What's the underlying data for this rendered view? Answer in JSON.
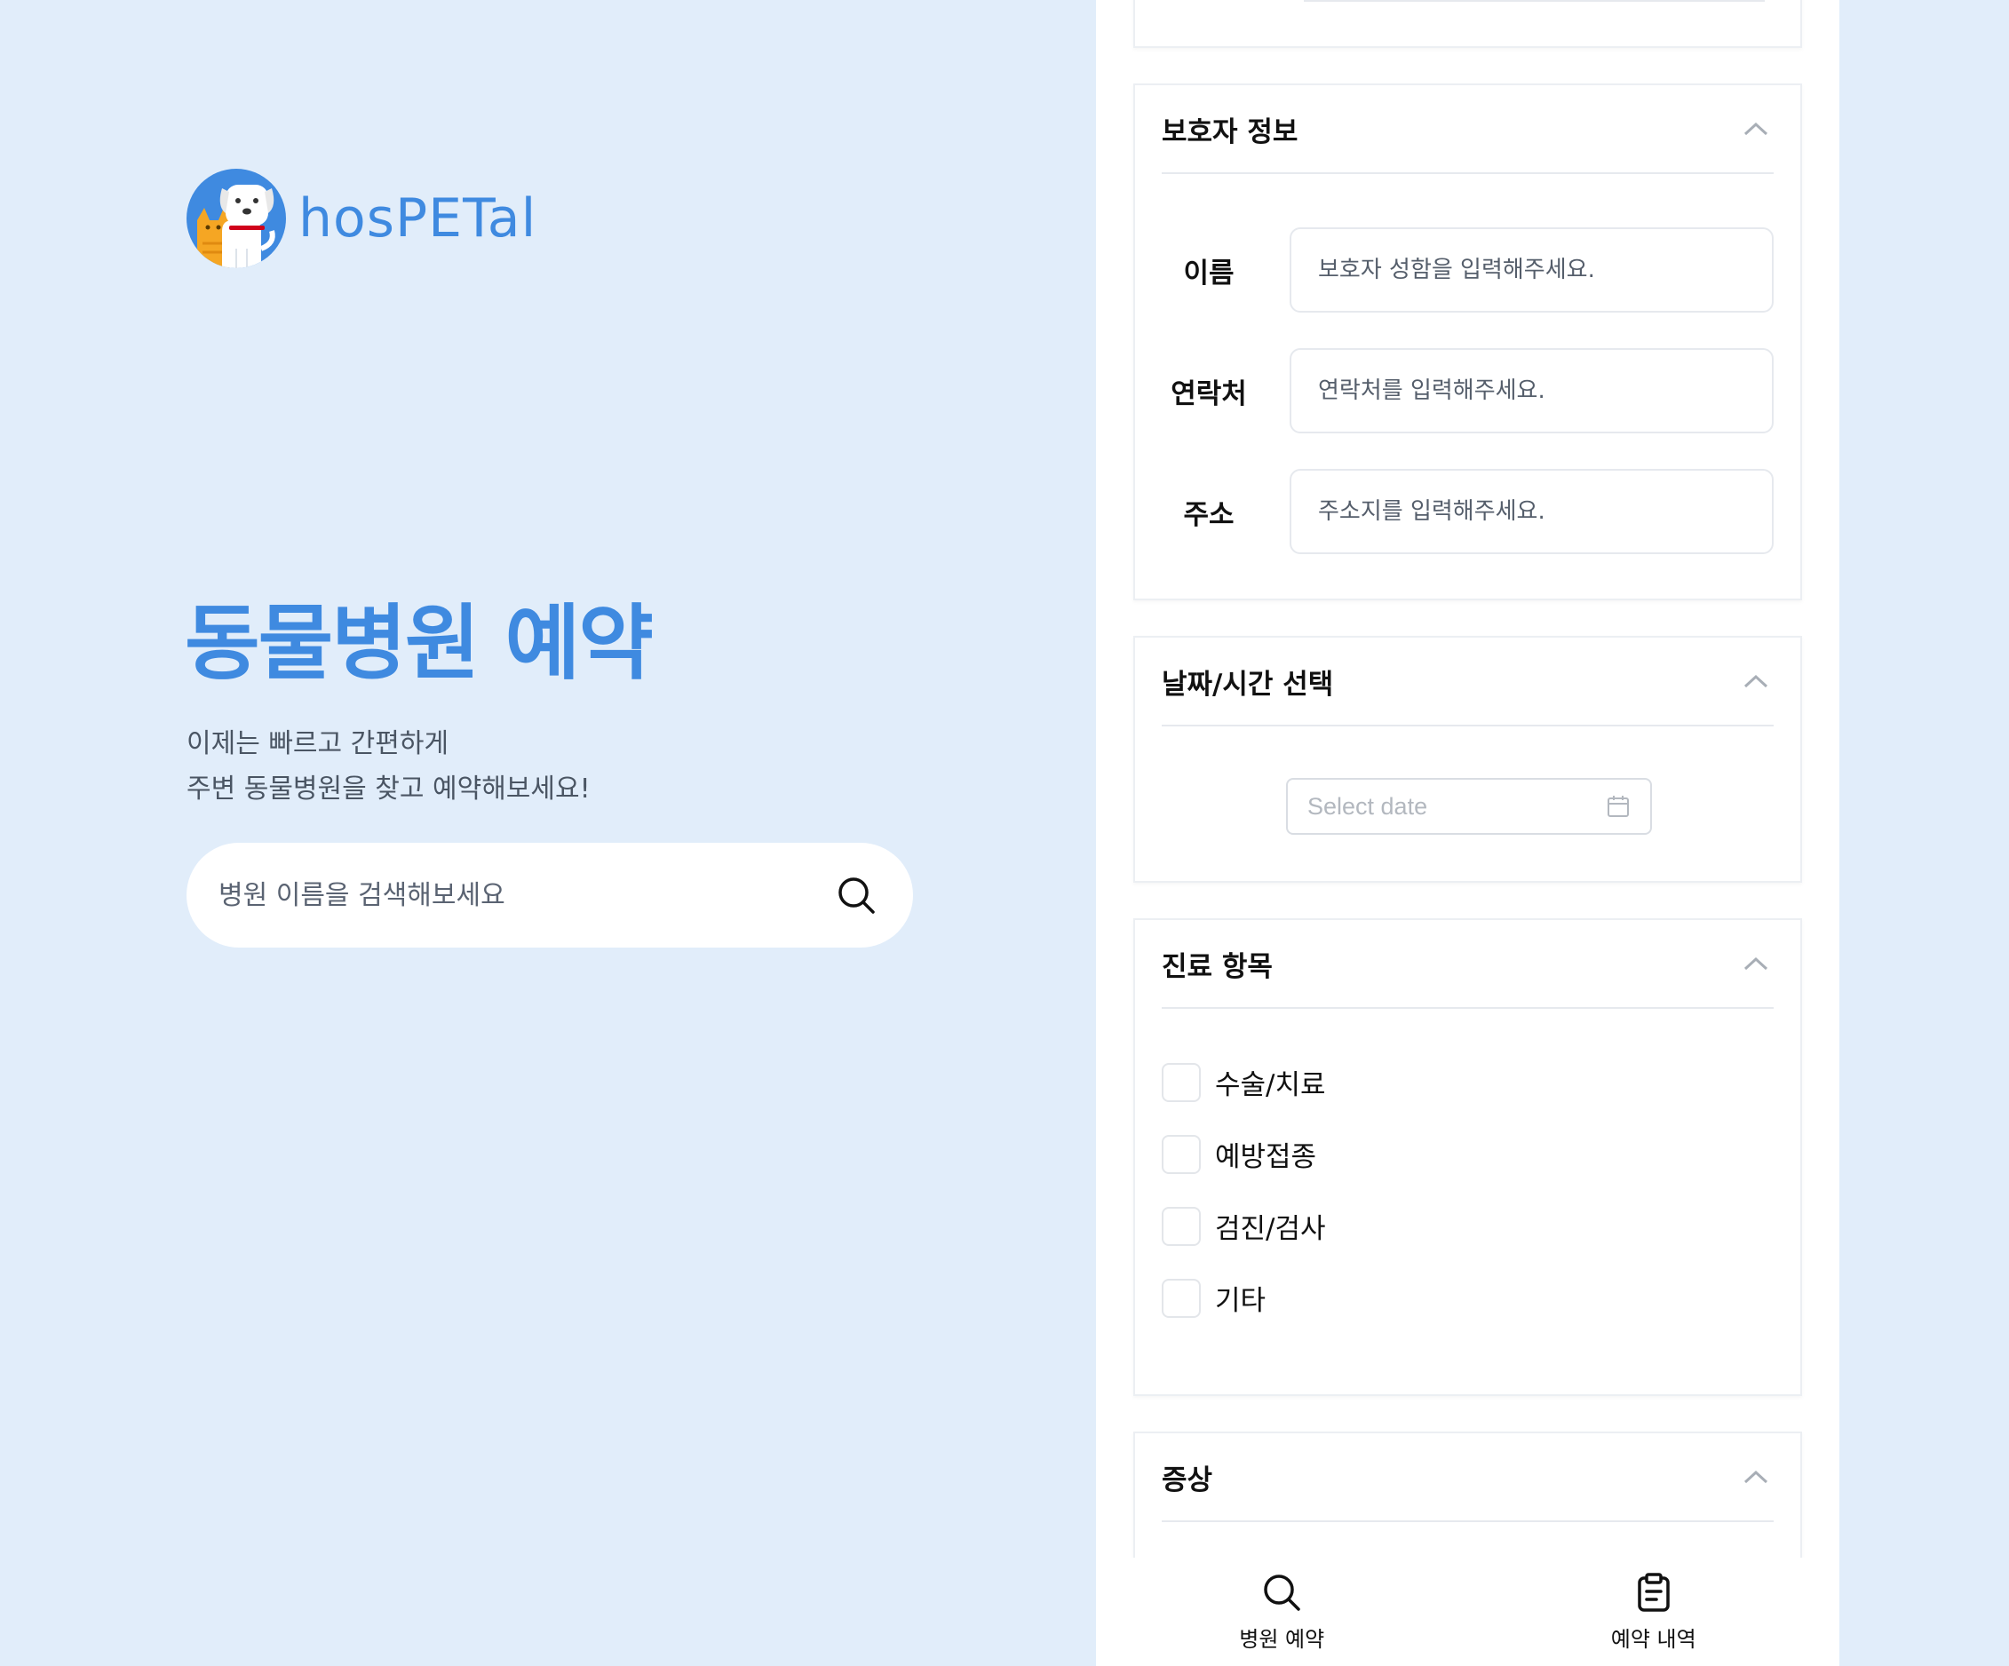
{
  "brand": {
    "name": "hosPETal",
    "accent": "#3f8ae0"
  },
  "hero": {
    "title": "동물병원 예약",
    "subtitle_line1": "이제는 빠르고 간편하게",
    "subtitle_line2": "주변 동물병원을 찾고 예약해보세요!",
    "search_placeholder": "병원 이름을 검색해보세요"
  },
  "guardian": {
    "title": "보호자 정보",
    "fields": [
      {
        "label": "이름",
        "placeholder": "보호자 성함을 입력해주세요."
      },
      {
        "label": "연락처",
        "placeholder": "연락처를 입력해주세요."
      },
      {
        "label": "주소",
        "placeholder": "주소지를 입력해주세요."
      }
    ]
  },
  "datetime": {
    "title": "날짜/시간 선택",
    "date_placeholder": "Select date"
  },
  "treatment": {
    "title": "진료 항목",
    "options": [
      "수술/치료",
      "예방접종",
      "검진/검사",
      "기타"
    ]
  },
  "symptom": {
    "title": "증상"
  },
  "nav": [
    {
      "label": "병원 예약",
      "icon": "search-icon"
    },
    {
      "label": "예약 내역",
      "icon": "clipboard-icon"
    }
  ]
}
